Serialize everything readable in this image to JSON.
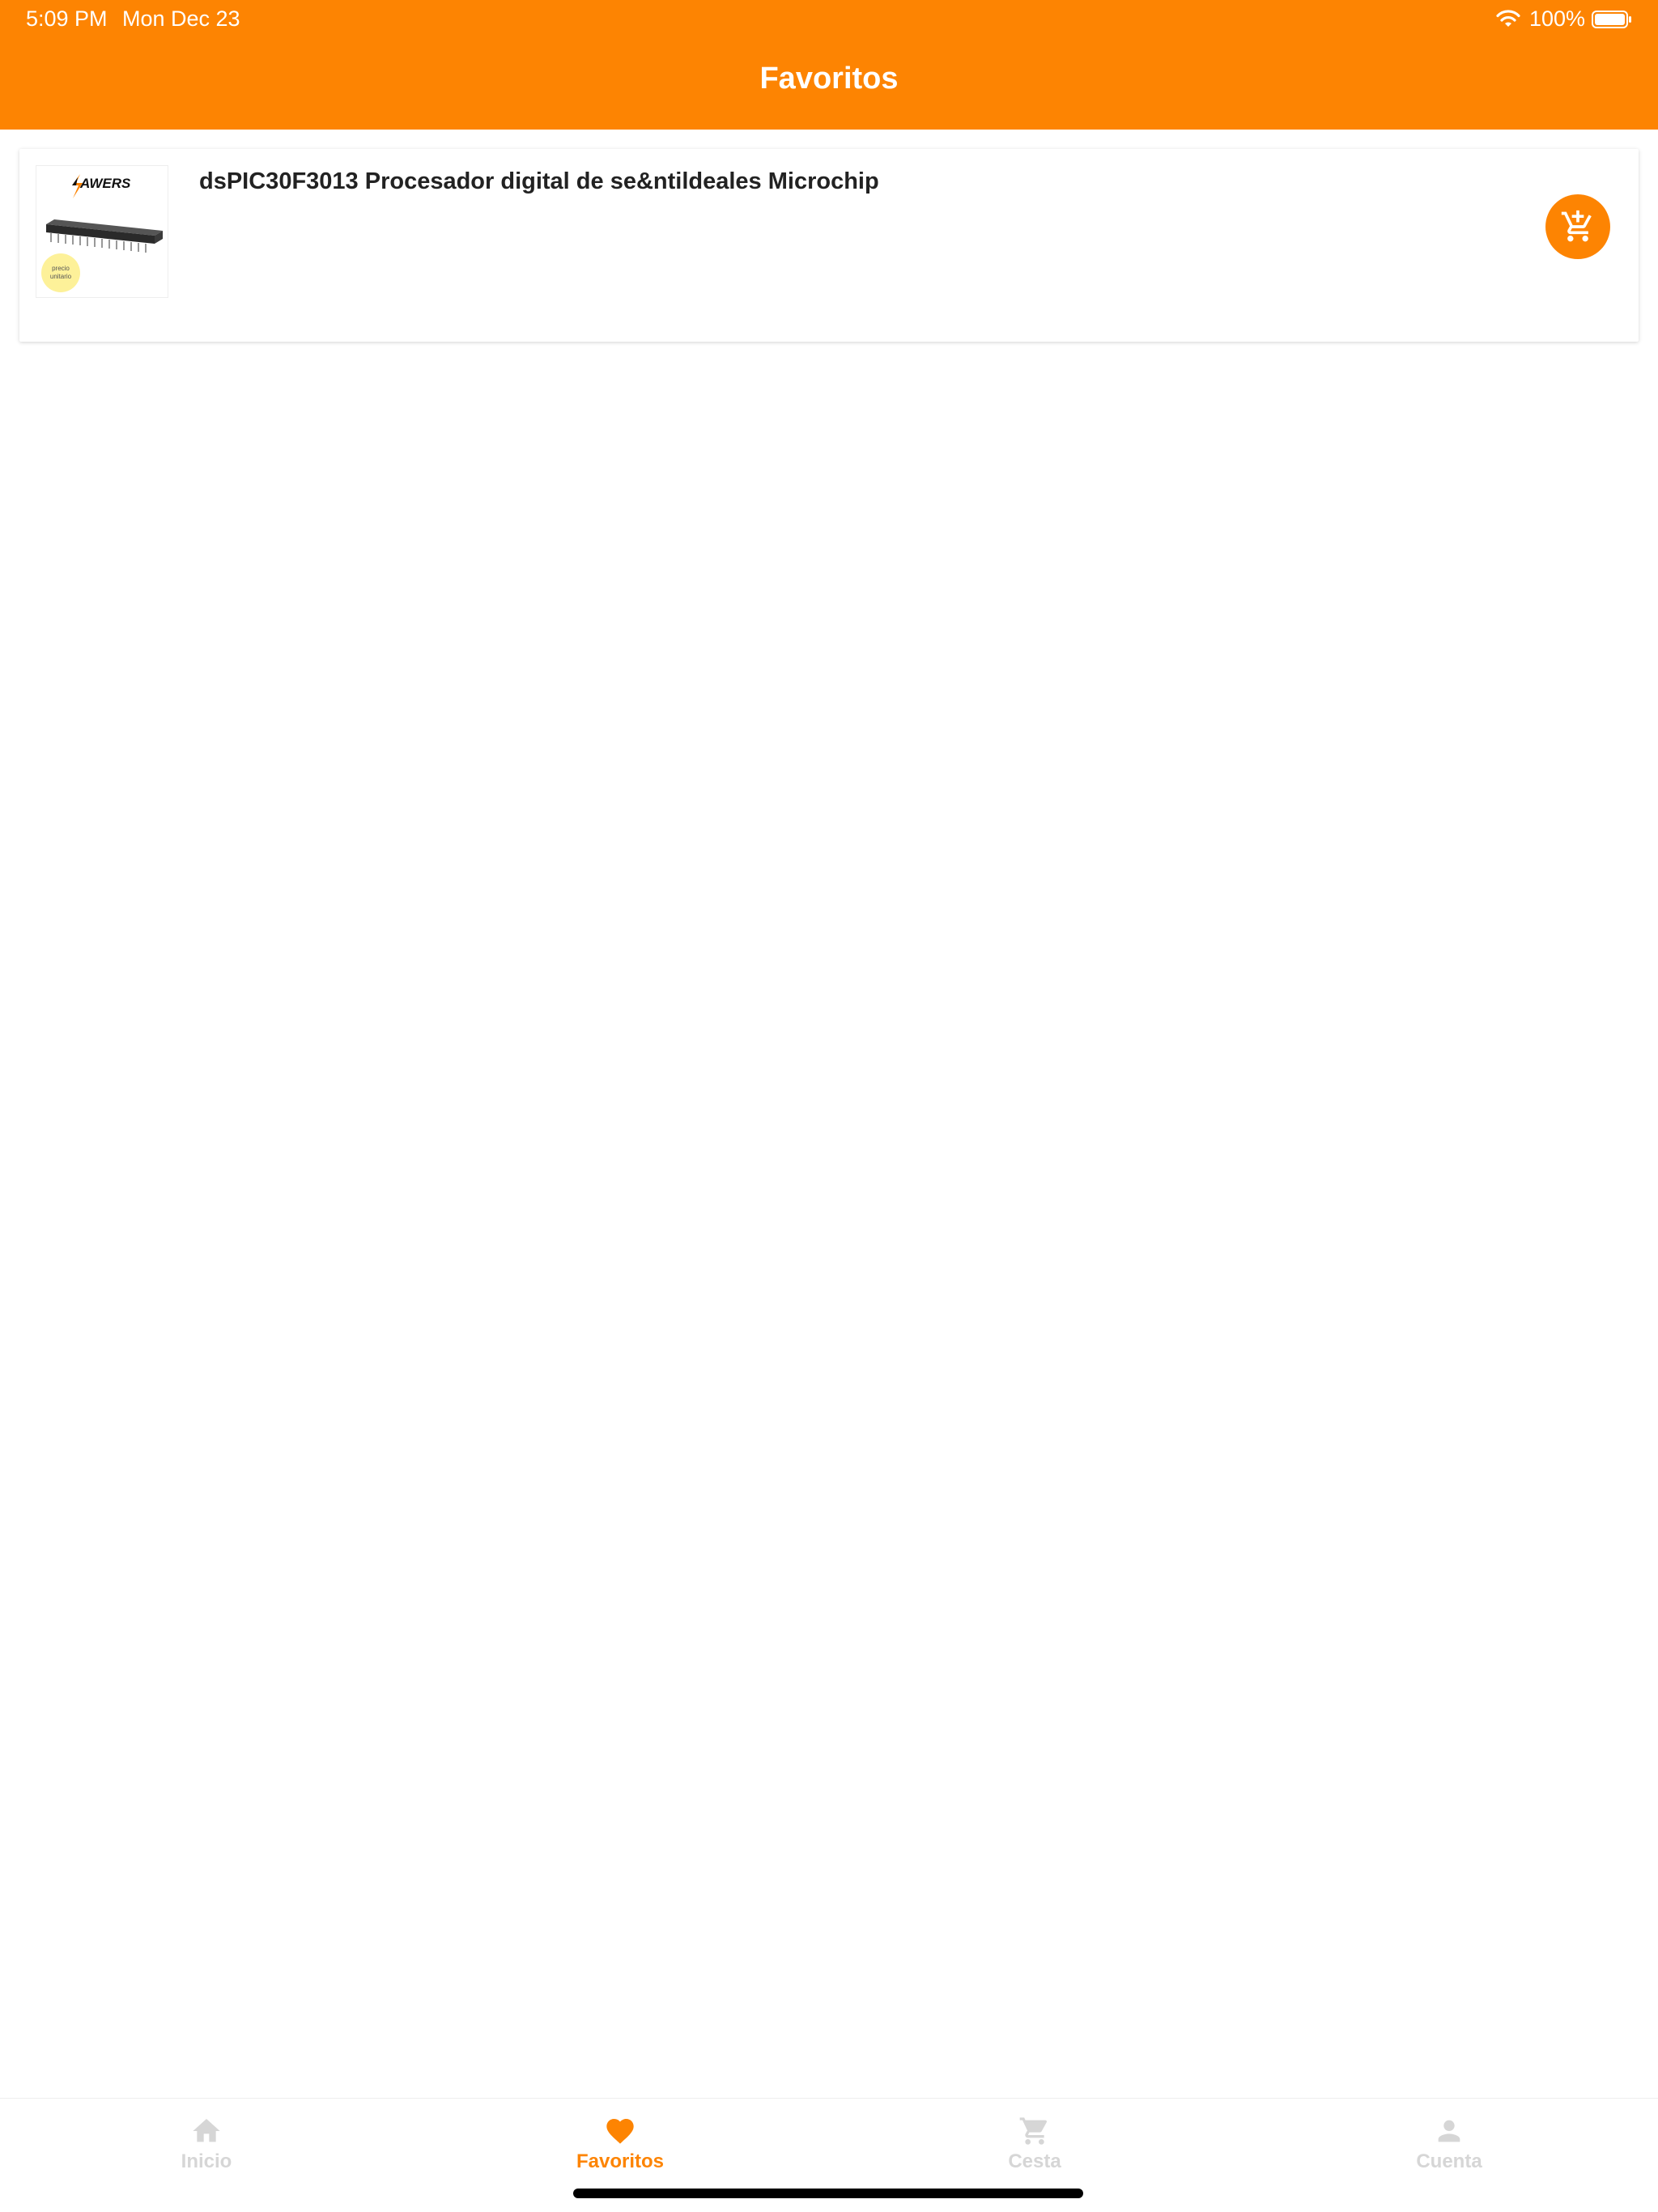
{
  "status_bar": {
    "time": "5:09 PM",
    "date": "Mon Dec 23",
    "battery": "100%"
  },
  "header": {
    "title": "Favoritos"
  },
  "favorites": [
    {
      "title": "dsPIC30F3013 Procesador digital de se&ntildeales Microchip",
      "image": {
        "brand": "AWERS",
        "badge_line1": "precio",
        "badge_line2": "unitario"
      },
      "add_to_cart_icon": "add-cart-icon"
    }
  ],
  "tabbar": {
    "items": [
      {
        "label": "Inicio",
        "icon": "home-icon",
        "active": false
      },
      {
        "label": "Favoritos",
        "icon": "heart-icon",
        "active": true
      },
      {
        "label": "Cesta",
        "icon": "cart-icon",
        "active": false
      },
      {
        "label": "Cuenta",
        "icon": "person-icon",
        "active": false
      }
    ]
  },
  "colors": {
    "accent": "#FD8402",
    "tab_inactive": "#D6D6D6",
    "badge": "#FDF199"
  }
}
